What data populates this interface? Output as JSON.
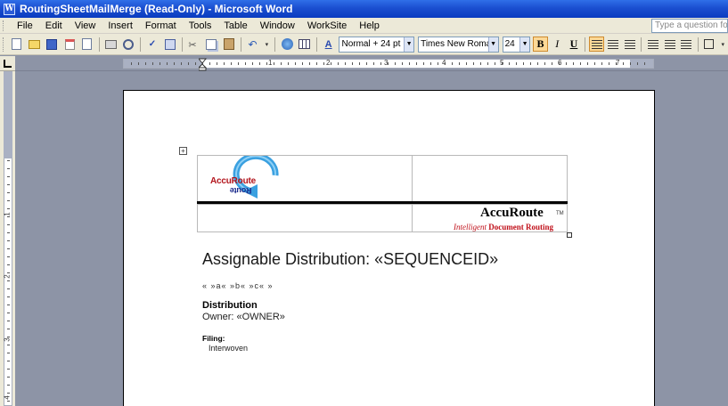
{
  "window": {
    "title": "RoutingSheetMailMerge (Read-Only) - Microsoft Word"
  },
  "menu": {
    "items": [
      {
        "label": "File"
      },
      {
        "label": "Edit"
      },
      {
        "label": "View"
      },
      {
        "label": "Insert"
      },
      {
        "label": "Format"
      },
      {
        "label": "Tools"
      },
      {
        "label": "Table"
      },
      {
        "label": "Window"
      },
      {
        "label": "WorkSite"
      },
      {
        "label": "Help"
      }
    ],
    "help_placeholder": "Type a question fo"
  },
  "toolbar": {
    "style_value": "Normal + 24 pt",
    "font_value": "Times New Roman",
    "size_value": "24",
    "bold_label": "B",
    "italic_label": "I",
    "underline_label": "U"
  },
  "ruler": {
    "h_numbers": [
      "1",
      "2",
      "3",
      "4",
      "5",
      "6",
      "7"
    ],
    "v_numbers": [
      "1",
      "2",
      "3",
      "4"
    ]
  },
  "document": {
    "logo_top": "AccuRoute",
    "logo_bottom": "Route",
    "brand": "AccuRoute",
    "brand_tm": "TM",
    "tagline_italic": "Intelligent",
    "tagline_bold": "Document Routing",
    "heading": "Assignable Distribution: «SEQUENCEID»",
    "field_codes": "« »a« »b« »c« »",
    "distribution_label": "Distribution",
    "owner_line": "Owner: «OWNER»",
    "filing_label": "Filing:",
    "filing_value": "Interwoven"
  },
  "colors": {
    "titlebar": "#0a3cc0",
    "brand_red": "#c0101a"
  }
}
